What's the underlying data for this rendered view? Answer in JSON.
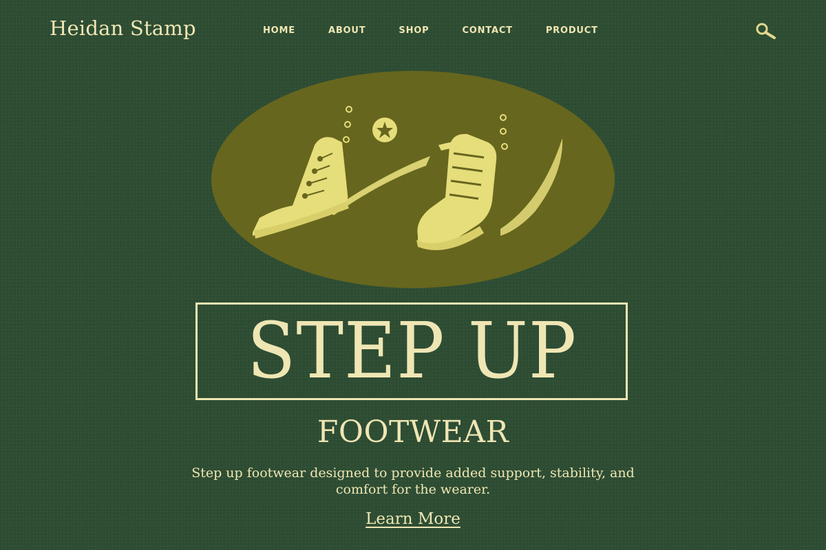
{
  "header": {
    "brand": "Heidan Stamp",
    "nav": [
      "HOME",
      "ABOUT",
      "SHOP",
      "CONTACT",
      "PRODUCT"
    ],
    "search_icon": "search-icon"
  },
  "hero": {
    "image_subject": "pair of high-top sneakers",
    "title": "STEP UP",
    "subtitle": "FOOTWEAR",
    "description_line1": "Step up footwear designed to provide added support, stability, and",
    "description_line2": "comfort for the wearer.",
    "cta_label": "Learn More"
  },
  "colors": {
    "background": "#2f4f34",
    "cream": "#efe6b4",
    "oval": "#66661e",
    "sneaker": "#e6dd7b"
  }
}
